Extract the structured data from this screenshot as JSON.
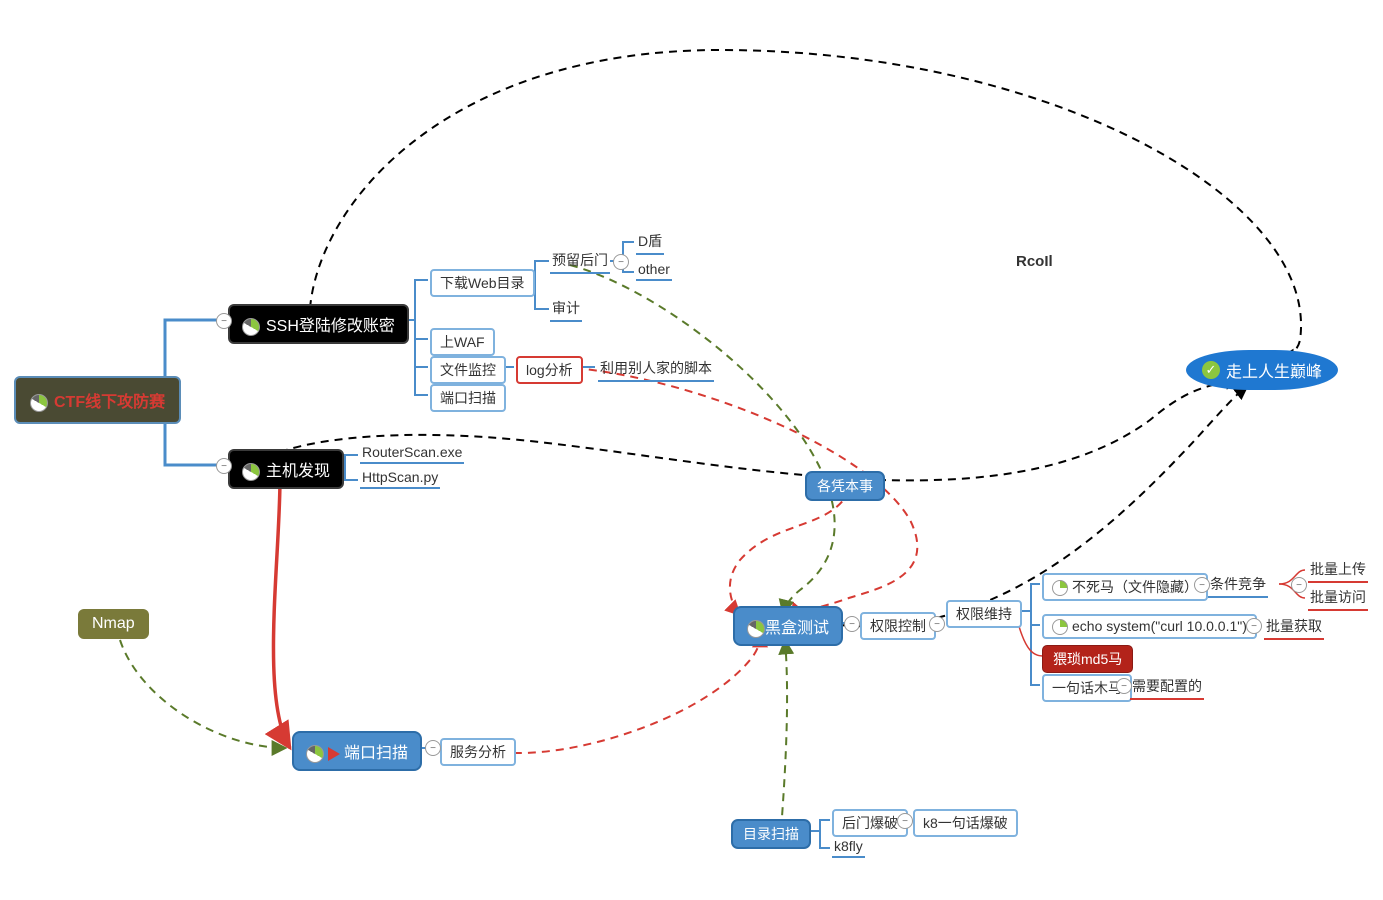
{
  "root": "CTF线下攻防赛",
  "author": "RcoIl",
  "ssh": {
    "label": "SSH登陆修改账密",
    "children": [
      "下载Web目录",
      "上WAF",
      "文件监控",
      "端口扫描"
    ],
    "web": [
      "预留后门",
      "审计"
    ],
    "backdoor": [
      "D盾",
      "other"
    ],
    "filemon": [
      "log分析",
      "利用别人家的脚本"
    ]
  },
  "host": {
    "label": "主机发现",
    "children": [
      "RouterScan.exe",
      "HttpScan.py"
    ]
  },
  "nmap": "Nmap",
  "portscan": {
    "label": "端口扫描",
    "child": "服务分析"
  },
  "blackbox": {
    "label": "黑盒测试",
    "child": "权限控制"
  },
  "priv": {
    "maintain": "权限维持",
    "children": [
      "不死马（文件隐藏）",
      "echo system(\"curl 10.0.0.1\")",
      "猥琐md5马",
      "一句话木马"
    ],
    "race": "条件竞争",
    "batch": [
      "批量上传",
      "批量访问",
      "批量获取"
    ],
    "config": "需要配置的"
  },
  "skill": "各凭本事",
  "dirscan": {
    "label": "目录扫描",
    "children": [
      "后门爆破",
      "k8fly"
    ],
    "k8": "k8一句话爆破"
  },
  "peak": "走上人生巅峰"
}
